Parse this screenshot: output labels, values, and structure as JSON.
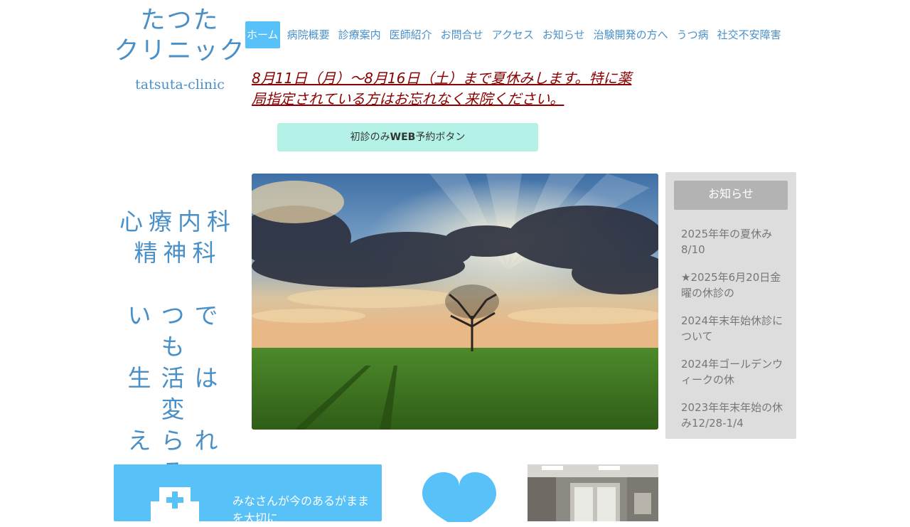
{
  "logo": {
    "line1": "たつた",
    "line2": "クリニック",
    "latin": "tatsuta-clinic"
  },
  "nav": {
    "items": [
      {
        "label": "ホーム",
        "active": true
      },
      {
        "label": "病院概要"
      },
      {
        "label": "診療案内"
      },
      {
        "label": "医師紹介"
      },
      {
        "label": "お問合せ"
      },
      {
        "label": "アクセス"
      },
      {
        "label": "お知らせ"
      },
      {
        "label": "治験開発の方へ"
      },
      {
        "label": "うつ病"
      },
      {
        "label": "社交不安障害"
      }
    ]
  },
  "notice": {
    "text": "8月11日（月）〜8月16日（土）まで夏休みします。特に薬局指定されている方はお忘れなく来院ください。"
  },
  "reserve_button": {
    "label_prefix": "初診のみ",
    "label_bold": "WEB",
    "label_suffix": "予約ボタン"
  },
  "taglines": {
    "department_1": "心療内科",
    "department_2": "精神科",
    "motto_1": "いつでも",
    "motto_2": "生活は変",
    "motto_3": "えられる"
  },
  "news": {
    "header": "お知らせ",
    "items": [
      "2025年年の夏休み8/10",
      "★2025年6月20日金曜の休診の",
      "2024年末年始休診について",
      "2024年ゴールデンウィークの休",
      "2023年年末年始の休み12/28-1/4"
    ]
  },
  "feature": {
    "text": "みなさんが今のあるがままを大切に"
  },
  "icons": {
    "hospital": "hospital-icon",
    "heart": "heart-icon"
  },
  "colors": {
    "accent": "#57c1f8",
    "brand_text": "#4a90c8",
    "notice": "#8b0000",
    "button_bg": "#b4f2e7",
    "news_bg": "#dddddd",
    "news_header_bg": "#b3b3b3"
  }
}
